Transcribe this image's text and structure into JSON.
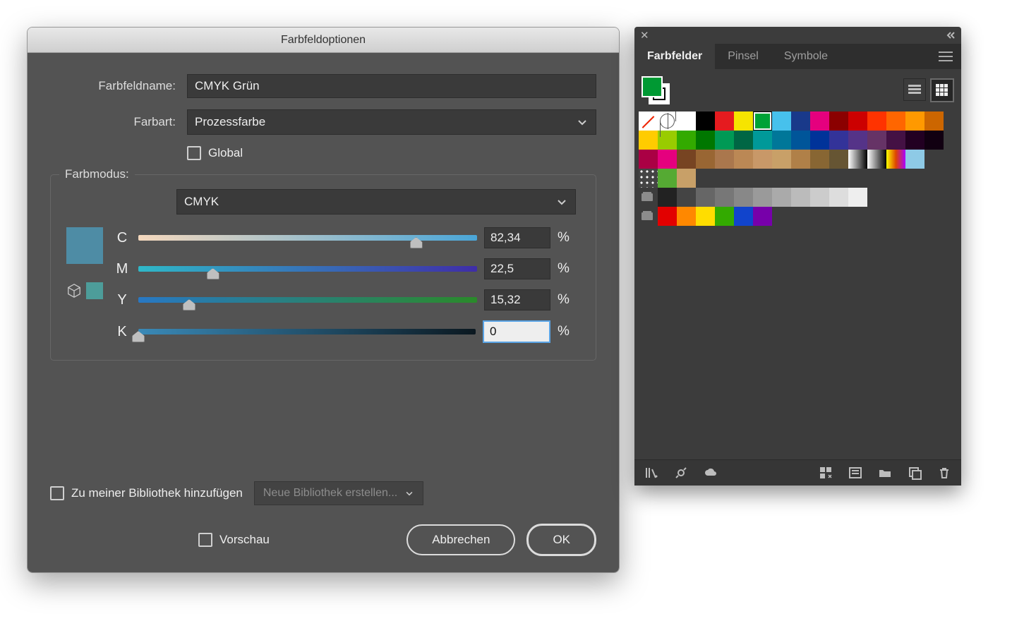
{
  "dialog": {
    "title": "Farbfeldoptionen",
    "name_label": "Farbfeldname:",
    "name_value": "CMYK Grün",
    "type_label": "Farbart:",
    "type_value": "Prozessfarbe",
    "global_label": "Global",
    "mode_legend": "Farbmodus:",
    "mode_value": "CMYK",
    "preview_color": "#4e8ca5",
    "preview_color2": "#4d9d9a",
    "channels": [
      {
        "label": "C",
        "value": "82,34",
        "pos": 82,
        "grad": "linear-gradient(90deg,#f5d8bd,#4aa6d8)"
      },
      {
        "label": "M",
        "value": "22,5",
        "pos": 22,
        "grad": "linear-gradient(90deg,#2fb8c8,#3f2da8)"
      },
      {
        "label": "Y",
        "value": "15,32",
        "pos": 15,
        "grad": "linear-gradient(90deg,#2878c4,#2a8a2a)"
      },
      {
        "label": "K",
        "value": "0",
        "pos": 0,
        "grad": "linear-gradient(90deg,#3a8ab8,#0b1820)",
        "focused": true
      }
    ],
    "percent": "%",
    "lib_checkbox": "Zu meiner Bibliothek hinzufügen",
    "lib_select": "Neue Bibliothek erstellen...",
    "preview_checkbox": "Vorschau",
    "cancel": "Abbrechen",
    "ok": "OK"
  },
  "panel": {
    "tabs": [
      "Farbfelder",
      "Pinsel",
      "Symbole"
    ],
    "active_tab": 0,
    "fg_color": "#009933",
    "rows": [
      [
        "none",
        "reg",
        "#ffffff",
        "#000000",
        "#e51b1f",
        "#f6e400",
        "#00a236",
        "#47c1ec",
        "#19398a",
        "#e5007e",
        "#8b0000",
        "#cc0000",
        "#ff3300",
        "#ff6600",
        "#ff9900",
        "#cc6600"
      ],
      [
        "#ffcc00",
        "#99cc00",
        "#33aa00",
        "#007700",
        "#009955",
        "#006644",
        "#009999",
        "#007799",
        "#005599",
        "#003399",
        "#333399",
        "#553388",
        "#663366",
        "#441144",
        "#220022",
        "#110011"
      ],
      [
        "#aa0044",
        "#e5007e",
        "#774422",
        "#996633",
        "#aa774d",
        "#bb8855",
        "#c89868",
        "#c8a068",
        "#b08048",
        "#886633",
        "#665533",
        "grad",
        "grad",
        "grad2",
        "#8ecae6"
      ],
      [
        "patt",
        "#55aa33",
        "#c8a068"
      ],
      [
        "folder",
        "#222222",
        "#444444",
        "#666666",
        "#777777",
        "#888888",
        "#9a9a9a",
        "#aaaaaa",
        "#bbbbbb",
        "#cccccc",
        "#dddddd",
        "#eeeeee"
      ],
      [
        "folder",
        "#e20000",
        "#ff8800",
        "#ffdd00",
        "#33aa00",
        "#1144cc",
        "#7700aa"
      ]
    ],
    "selected": {
      "row": 0,
      "col": 6
    }
  }
}
